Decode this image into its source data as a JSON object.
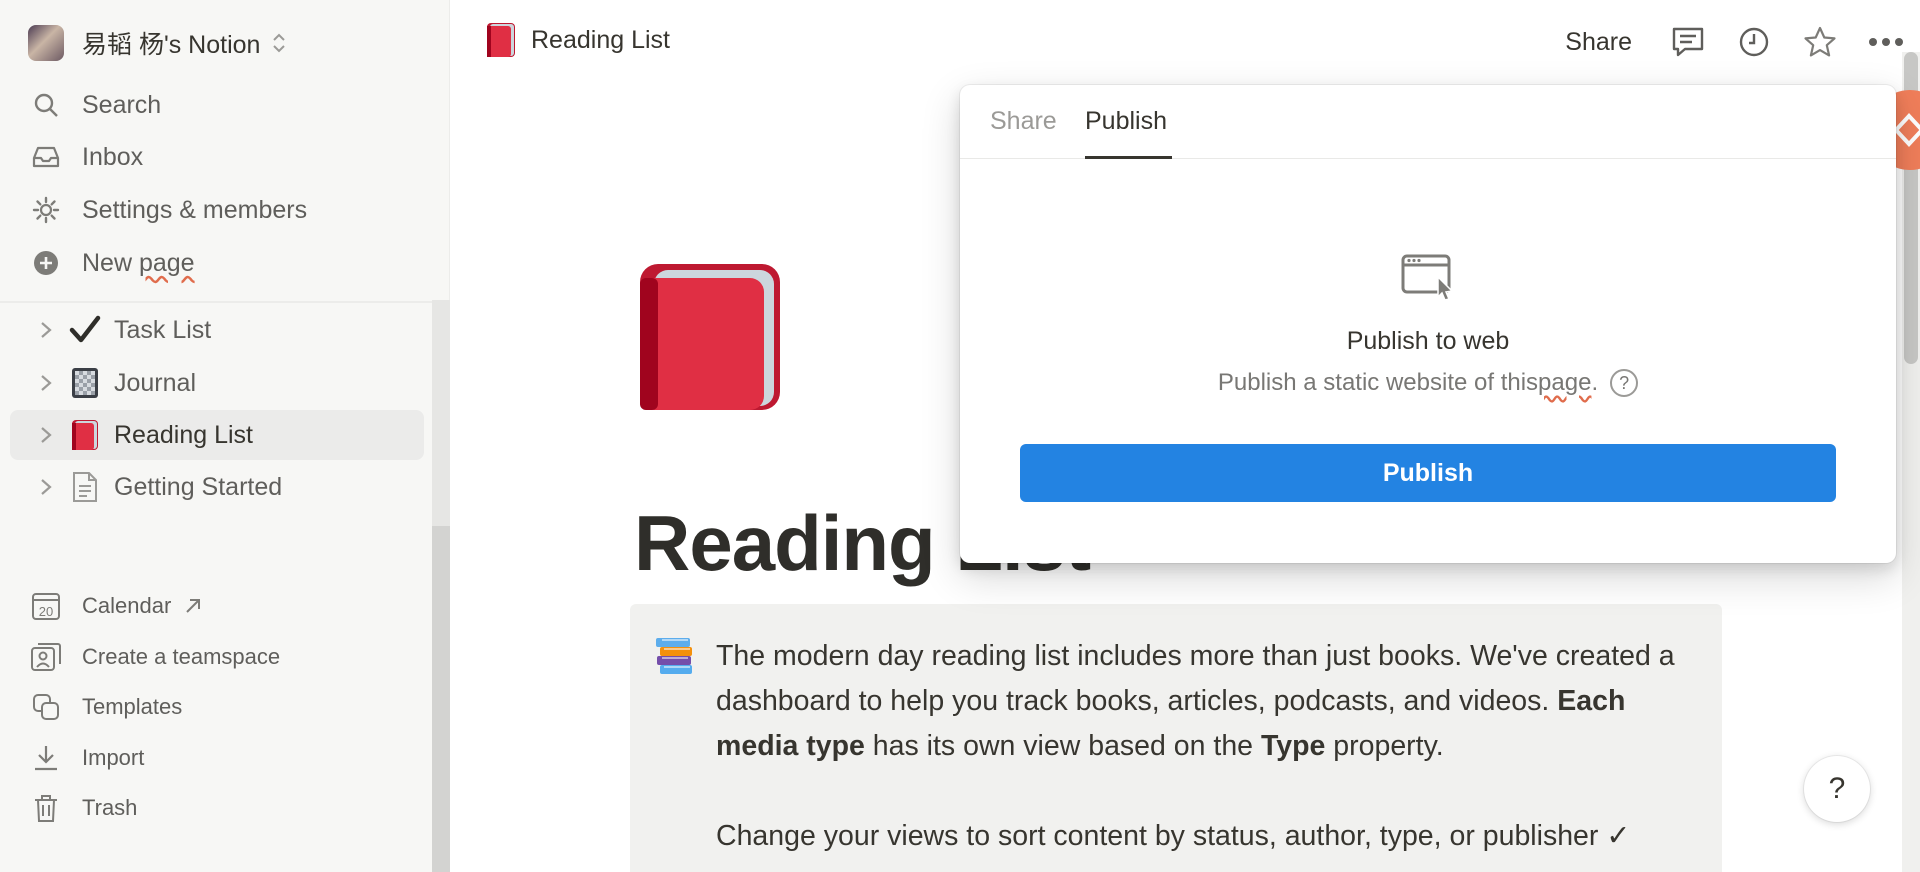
{
  "sidebar": {
    "workspace_name": "易韬 杨's Notion",
    "nav": {
      "search": "Search",
      "inbox": "Inbox",
      "settings": "Settings & members",
      "new_page_a": "New ",
      "new_page_b": "page"
    },
    "pages": [
      {
        "label": "Task List",
        "icon": "check-icon"
      },
      {
        "label": "Journal",
        "icon": "journal-icon"
      },
      {
        "label": "Reading List",
        "icon": "red-book-icon"
      },
      {
        "label": "Getting Started",
        "icon": "document-icon"
      }
    ],
    "bottom": {
      "calendar": "Calendar",
      "calendar_day": "20",
      "teamspace": "Create a teamspace",
      "templates": "Templates",
      "import": "Import",
      "trash": "Trash"
    }
  },
  "topbar": {
    "breadcrumb": "Reading List",
    "share_label": "Share"
  },
  "page": {
    "title": "Reading List",
    "callout": {
      "p1_a": "The modern day reading list includes more than just books. We've created a dashboard to help you track books, articles, podcasts, and videos. ",
      "p1_b": "Each media type",
      "p1_c": " has its own view based on the ",
      "p1_d": "Type",
      "p1_e": " property.",
      "p2": "Change your views to sort content by status, author, type, or publisher ✓"
    }
  },
  "popover": {
    "tab_share": "Share",
    "tab_publish": "Publish",
    "heading": "Publish to web",
    "desc_a": "Publish a static website of this",
    "desc_b": "page",
    "desc_c": ".",
    "help_glyph": "?",
    "button": "Publish"
  },
  "help_fab": "?",
  "colors": {
    "accent": "#2383e2",
    "sidebar_bg": "#f7f7f5",
    "book_red": "#e02f44"
  }
}
